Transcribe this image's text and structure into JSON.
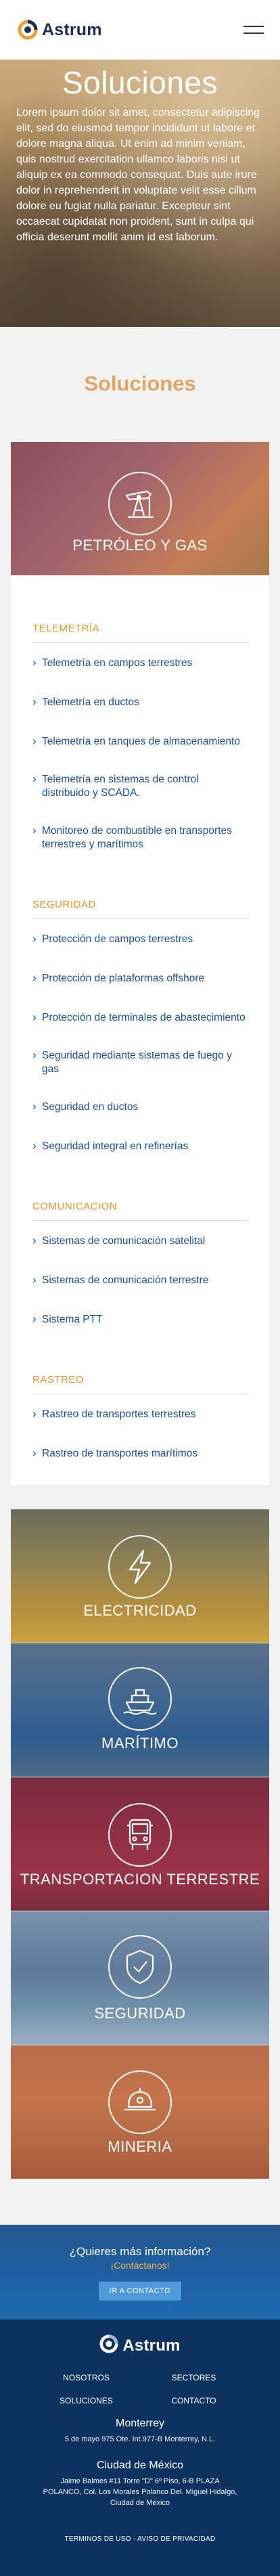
{
  "header": {
    "logo_text": "Astrum",
    "menu_icon": "hamburger-menu-icon"
  },
  "hero": {
    "title": "Soluciones",
    "text": "Lorem ipsum dolor sit amet, consectetur adipiscing elit, sed do eiusmod tempor incididunt ut labore et dolore magna aliqua. Ut enim ad minim veniam, quis nostrud exercitation ullamco laboris nisi ut aliquip ex ea commodo consequat. Duis aute irure dolor in reprehenderit in voluptate velit esse cillum dolore eu fugiat nulla pariatur. Excepteur sint occaecat cupidatat non proident, sunt in culpa qui officia deserunt mollit anim id est laborum."
  },
  "section": {
    "title": "Soluciones"
  },
  "petroleo": {
    "label": "PETRÓLEO Y GAS",
    "icon": "oil-pump-icon",
    "categories": [
      {
        "title": "TELEMETRÍA",
        "items": [
          "Telemetría en campos terrestres",
          "Telemetría en ductos",
          "Telemetría en tanques de almacenamiento",
          "Telemetría en sistemas de control distribuido y SCADA.",
          "Monitoreo de combustible en transportes terrestres y marítimos"
        ]
      },
      {
        "title": "SEGURIDAD",
        "items": [
          "Protección de campos terrestres",
          "Protección de plataformas offshore",
          "Protección de terminales de abastecimiento",
          "Seguridad mediante sistemas de fuego y gas",
          "Seguridad en ductos",
          "Seguridad integral en refinerías"
        ]
      },
      {
        "title": "COMUNICACION",
        "items": [
          "Sistemas de comunicación satelital",
          "Sistemas de comunicación terrestre",
          "Sistema PTT"
        ]
      },
      {
        "title": "RASTREO",
        "items": [
          "Rastreo de transportes terrestres",
          "Rastreo de transportes marítimos"
        ]
      }
    ]
  },
  "tiles": [
    {
      "label": "ELECTRICIDAD",
      "icon": "lightning-bolt-icon"
    },
    {
      "label": "MARÍTIMO",
      "icon": "ship-icon"
    },
    {
      "label": "TRANSPORTACION TERRESTRE",
      "icon": "truck-icon"
    },
    {
      "label": "SEGURIDAD",
      "icon": "shield-check-icon"
    },
    {
      "label": "MINERIA",
      "icon": "hard-hat-icon"
    }
  ],
  "contact": {
    "question": "¿Quieres más información?",
    "sub": "¡Contáctanos!",
    "button": "IR A CONTACTO"
  },
  "footer": {
    "logo_text": "Astrum",
    "nav": [
      "NOSOTROS",
      "SECTORES",
      "SOLUCIONES",
      "CONTACTO"
    ],
    "offices": [
      {
        "city": "Monterrey",
        "address": "5 de mayo 975 Ote. Int.977-B Monterrey, N.L."
      },
      {
        "city": "Ciudad de México",
        "address": "Jaime Balmes #11 Torre \"D\" 6º Piso, 6-B PLAZA POLANCO, Col. Los Morales Polanco Del. Miguel Hidalgo, Ciudad de México"
      }
    ],
    "legal": [
      "TERMINOS DE USO",
      "AVISO DE PRIVACIDAD"
    ]
  }
}
